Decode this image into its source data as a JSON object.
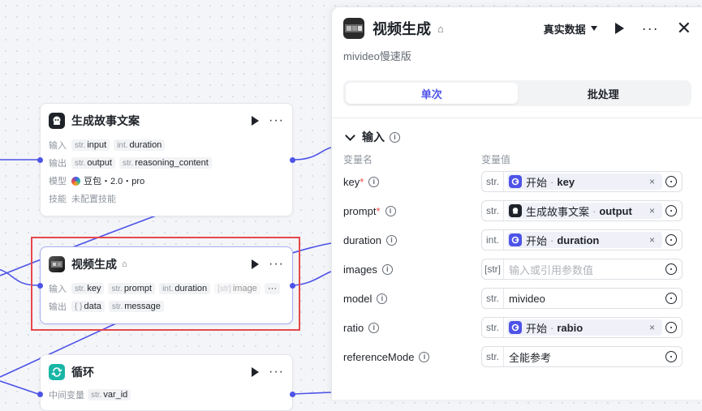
{
  "nodes": {
    "story": {
      "title": "生成故事文案",
      "input_label": "输入",
      "output_label": "输出",
      "model_label": "模型",
      "skill_label": "技能",
      "inputs": [
        {
          "type": "str.",
          "name": "input"
        },
        {
          "type": "int.",
          "name": "duration"
        }
      ],
      "outputs": [
        {
          "type": "str.",
          "name": "output"
        },
        {
          "type": "str.",
          "name": "reasoning_content"
        }
      ],
      "model": "豆包・2.0・pro",
      "skill": "未配置技能"
    },
    "video": {
      "title": "视频生成",
      "input_label": "输入",
      "output_label": "输出",
      "inputs": [
        {
          "type": "str.",
          "name": "key"
        },
        {
          "type": "str.",
          "name": "prompt"
        },
        {
          "type": "int.",
          "name": "duration"
        },
        {
          "type": "[str]",
          "name": "image"
        }
      ],
      "outputs": [
        {
          "type": "{ }",
          "name": "data"
        },
        {
          "type": "str.",
          "name": "message"
        }
      ]
    },
    "loop": {
      "title": "循环",
      "var_label": "中间变量",
      "var": {
        "type": "str.",
        "name": "var_id"
      }
    }
  },
  "panel": {
    "title": "视频生成",
    "subtitle": "mivideo慢速版",
    "data_select": "真实数据",
    "tabs": [
      {
        "label": "单次"
      },
      {
        "label": "批处理"
      }
    ],
    "section": "输入",
    "col_name": "变量名",
    "col_value": "变量值",
    "params": [
      {
        "name": "key",
        "required": "*",
        "type": "str.",
        "ref_node": "开始",
        "ref_var": "key",
        "ref_icon": "start"
      },
      {
        "name": "prompt",
        "required": "*",
        "type": "str.",
        "ref_node": "生成故事文案",
        "ref_var": "output",
        "ref_icon": "llm"
      },
      {
        "name": "duration",
        "required": "",
        "type": "int.",
        "ref_node": "开始",
        "ref_var": "duration",
        "ref_icon": "start"
      },
      {
        "name": "images",
        "required": "",
        "type": "[str]",
        "placeholder": "输入或引用参数值"
      },
      {
        "name": "model",
        "required": "",
        "type": "str.",
        "value": "mivideo"
      },
      {
        "name": "ratio",
        "required": "",
        "type": "str.",
        "ref_node": "开始",
        "ref_var": "rabio",
        "ref_icon": "start"
      },
      {
        "name": "referenceMode",
        "required": "",
        "type": "str.",
        "value": "全能参考"
      }
    ],
    "dot_sep": "·",
    "clear": "×"
  },
  "colors": {
    "accent": "#4d53e8",
    "selection": "#e5484d",
    "wire": "#4d53e8",
    "loop": "#19b6a6"
  }
}
